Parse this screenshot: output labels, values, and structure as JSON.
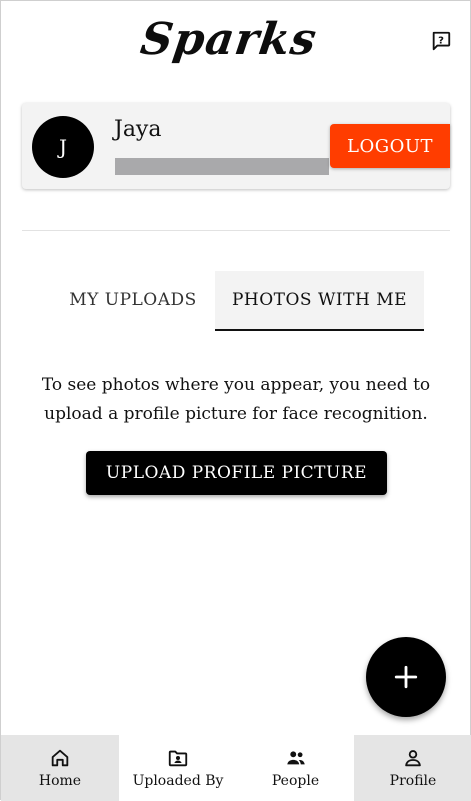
{
  "header": {
    "brand": "Sparks",
    "help_icon": "help-chat-icon"
  },
  "profile": {
    "avatar_initial": "J",
    "name": "Jaya",
    "logout_label": "LOGOUT"
  },
  "tabs": [
    {
      "label": "MY UPLOADS",
      "active": false
    },
    {
      "label": "PHOTOS WITH ME",
      "active": true
    }
  ],
  "content": {
    "message_line1": "To see photos where you appear, you need to",
    "message_line2": "upload a profile picture for face recognition.",
    "upload_button_label": "UPLOAD PROFILE PICTURE"
  },
  "fab": {
    "icon": "plus-icon"
  },
  "bottom_nav": [
    {
      "label": "Home",
      "icon": "home-icon"
    },
    {
      "label": "Uploaded By",
      "icon": "folder-user-icon"
    },
    {
      "label": "People",
      "icon": "people-icon"
    },
    {
      "label": "Profile",
      "icon": "person-icon"
    }
  ],
  "colors": {
    "logout": "#ff3d00",
    "primary": "#000000",
    "card_bg": "#f3f3f3",
    "nav_bg": "#e5e5e5"
  }
}
